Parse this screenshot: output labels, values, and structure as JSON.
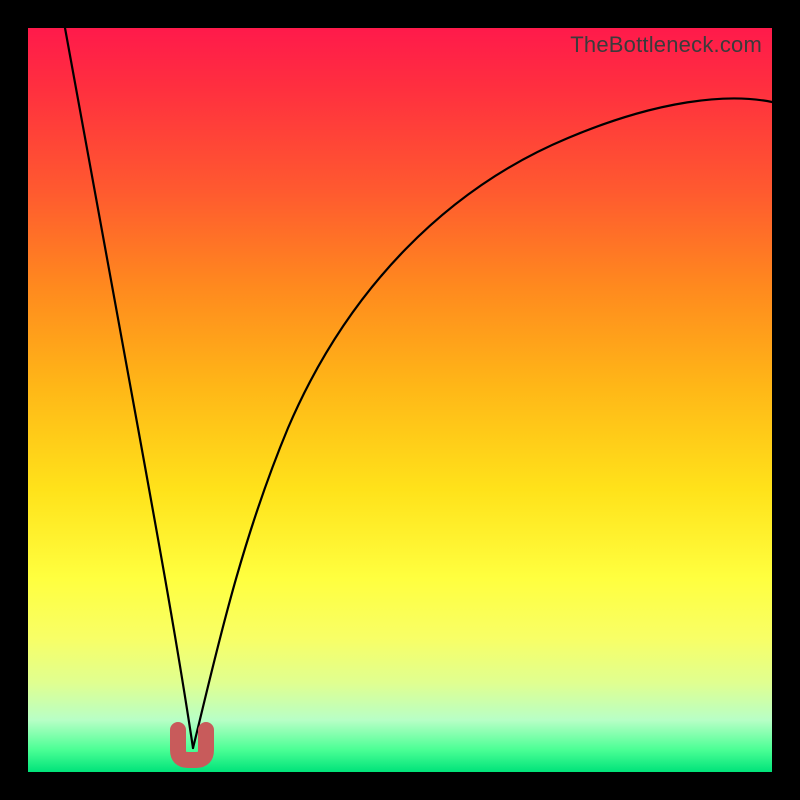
{
  "watermark": "TheBottleneck.com",
  "colors": {
    "frame_bg": "#000000",
    "curve": "#000000",
    "marker": "#c85b5b",
    "gradient_top": "#ff1a4b",
    "gradient_bottom": "#00e37a"
  },
  "chart_data": {
    "type": "line",
    "title": "",
    "xlabel": "",
    "ylabel": "",
    "xlim": [
      0,
      100
    ],
    "ylim": [
      0,
      100
    ],
    "note": "No axis ticks or numeric labels are rendered in the image; values below are geometric estimates (percent of plot area) read from gridless pixels.",
    "series": [
      {
        "name": "left-branch",
        "x": [
          5,
          8,
          11,
          14,
          17,
          20,
          22
        ],
        "y": [
          100,
          80,
          60,
          40,
          20,
          5,
          0
        ]
      },
      {
        "name": "right-branch",
        "x": [
          22,
          25,
          30,
          37,
          45,
          55,
          67,
          80,
          93,
          100
        ],
        "y": [
          0,
          12,
          30,
          48,
          60,
          70,
          78,
          84,
          88,
          90
        ]
      }
    ],
    "marker": {
      "name": "optimal-point",
      "shape": "U",
      "x_range": [
        20,
        24
      ],
      "y_range": [
        0,
        3
      ]
    }
  }
}
